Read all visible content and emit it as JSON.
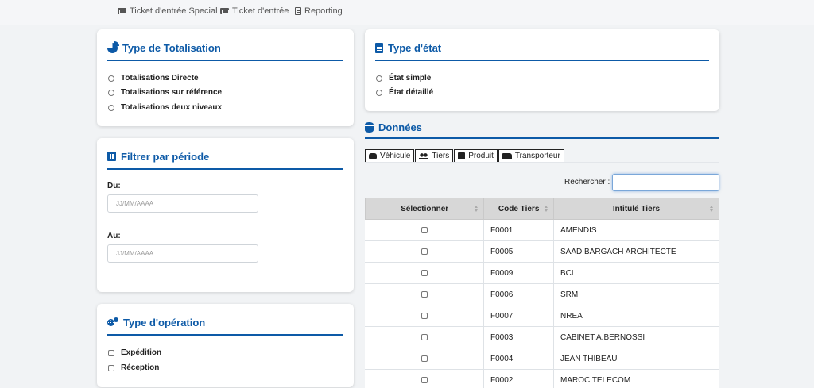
{
  "topnav": {
    "items": [
      {
        "label": "Ticket d'entrée Special",
        "icon": "ticket-icon"
      },
      {
        "label": "Ticket d'entrée",
        "icon": "ticket-icon"
      },
      {
        "label": "Reporting",
        "icon": "file-icon"
      }
    ]
  },
  "totalisation": {
    "title": "Type de Totalisation",
    "icon": "pie-chart-icon",
    "options": [
      "Totalisations Directe",
      "Totalisations sur référence",
      "Totalisations deux niveaux"
    ]
  },
  "periode": {
    "title": "Filtrer par période",
    "icon": "calendar-icon",
    "du_label": "Du:",
    "au_label": "Au:",
    "placeholder": "JJ/MM/AAAA"
  },
  "operation": {
    "title": "Type d'opération",
    "icon": "cogs-icon",
    "options": [
      "Expédition",
      "Réception"
    ]
  },
  "etat": {
    "title": "Type d'état",
    "icon": "file-text-icon",
    "options": [
      "État simple",
      "État détaillé"
    ]
  },
  "donnees": {
    "title": "Données",
    "icon": "database-icon",
    "tabs": [
      {
        "label": "Véhicule",
        "icon": "car-icon"
      },
      {
        "label": "Tiers",
        "icon": "users-icon"
      },
      {
        "label": "Produit",
        "icon": "box-icon"
      },
      {
        "label": "Transporteur",
        "icon": "truck-icon"
      }
    ],
    "search_label": "Rechercher :",
    "search_value": "",
    "columns": [
      "Sélectionner",
      "Code Tiers",
      "Intitulé Tiers"
    ],
    "rows": [
      {
        "code": "F0001",
        "name": "AMENDIS"
      },
      {
        "code": "F0005",
        "name": "SAAD BARGACH ARCHITECTE"
      },
      {
        "code": "F0009",
        "name": "BCL"
      },
      {
        "code": "F0006",
        "name": "SRM"
      },
      {
        "code": "F0007",
        "name": "NREA"
      },
      {
        "code": "F0003",
        "name": "CABINET.A.BERNOSSI"
      },
      {
        "code": "F0004",
        "name": "JEAN THIBEAU"
      },
      {
        "code": "F0002",
        "name": "MAROC TELECOM"
      }
    ]
  }
}
